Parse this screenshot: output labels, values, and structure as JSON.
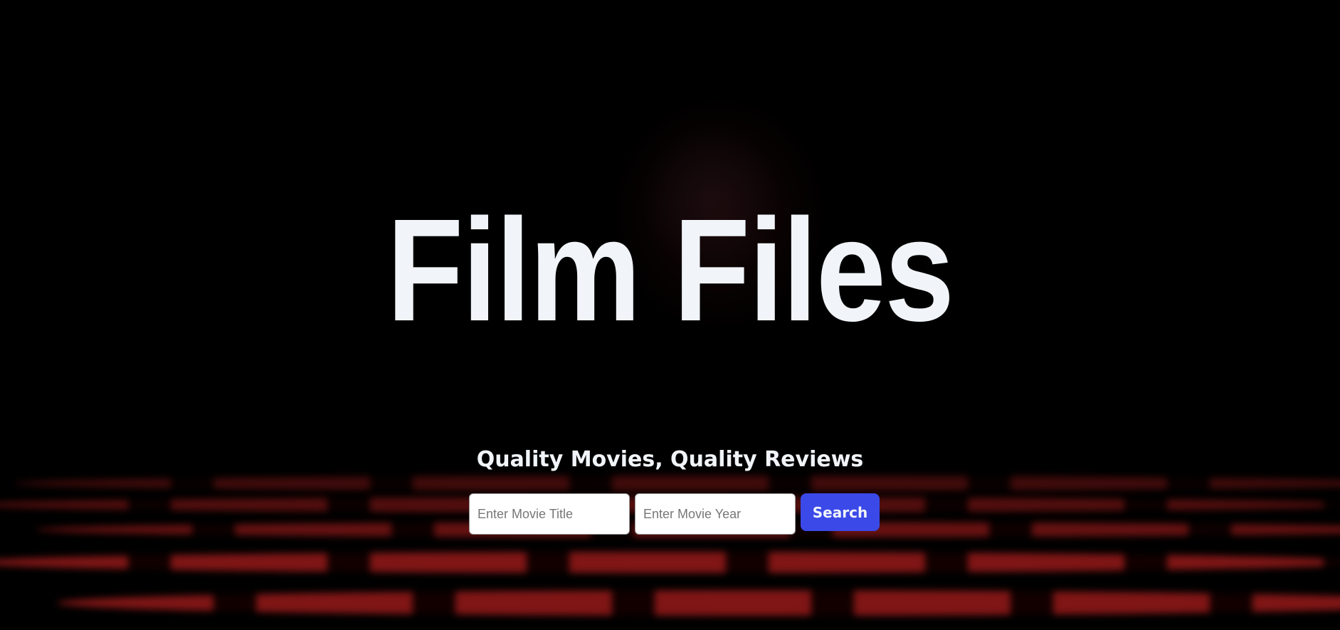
{
  "hero": {
    "title": "Film Files",
    "subtitle": "Quality Movies, Quality Reviews"
  },
  "search": {
    "title_placeholder": "Enter Movie Title",
    "year_placeholder": "Enter Movie Year",
    "button_label": "Search",
    "button_color": "#3b49e8"
  }
}
